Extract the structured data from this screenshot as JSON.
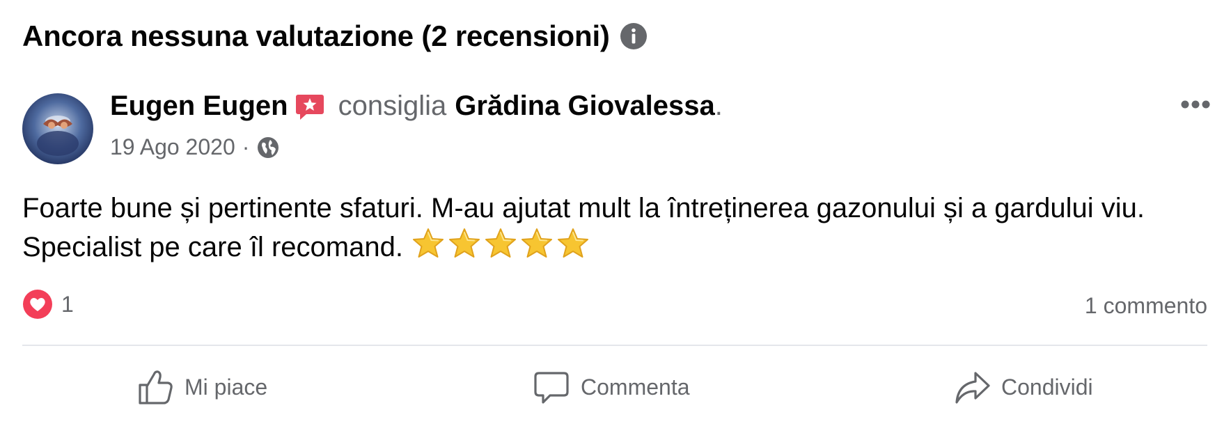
{
  "header": {
    "title": "Ancora nessuna valutazione (2 recensioni)",
    "info_icon": "info-icon"
  },
  "review": {
    "author": "Eugen Eugen",
    "badge_icon": "recommend-badge-icon",
    "verb": "consiglia",
    "page_name": "Grădina Giovalessa",
    "period": ".",
    "date": "19 Ago 2020",
    "separator": "·",
    "privacy_icon": "globe-icon",
    "text": "Foarte bune și pertinente sfaturi. M-au ajutat mult la întreținerea gazonului și a gardului viu. Specialist pe care îl recomand.",
    "stars": 5
  },
  "reactions": {
    "icon": "love-reaction-icon",
    "count": "1",
    "comments": "1 commento"
  },
  "actions": {
    "like": "Mi piace",
    "comment": "Commenta",
    "share": "Condividi"
  },
  "colors": {
    "text": "#050505",
    "secondary": "#65676b",
    "divider": "#e4e6eb",
    "love": "#f33e58",
    "badge": "#e6485d"
  }
}
